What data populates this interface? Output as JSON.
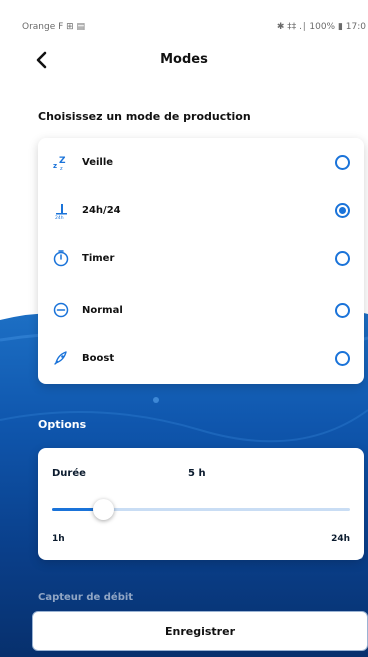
{
  "status": {
    "left": "Orange F ⊞ ▤",
    "right": "✱ ‡‡ .∣ 100% ▮ 17:0"
  },
  "header": {
    "title": "Modes"
  },
  "production": {
    "title": "Choisissez un mode de production",
    "modes": [
      {
        "label": "Veille",
        "icon": "sleep-icon",
        "selected": false
      },
      {
        "label": "24h/24",
        "icon": "24h-icon",
        "selected": true
      },
      {
        "label": "Timer",
        "icon": "timer-icon",
        "selected": false
      },
      {
        "label": "Normal",
        "icon": "normal-icon",
        "selected": false
      },
      {
        "label": "Boost",
        "icon": "boost-icon",
        "selected": false
      }
    ]
  },
  "options": {
    "title": "Options",
    "duration_label": "Durée",
    "duration_value": "5 h",
    "slider_min": "1h",
    "slider_max": "24h",
    "slider_fraction": 0.17
  },
  "debit": {
    "title": "Capteur de débit"
  },
  "save_label": "Enregistrer",
  "colors": {
    "accent": "#1a73d9",
    "water": "#0f56ad"
  }
}
